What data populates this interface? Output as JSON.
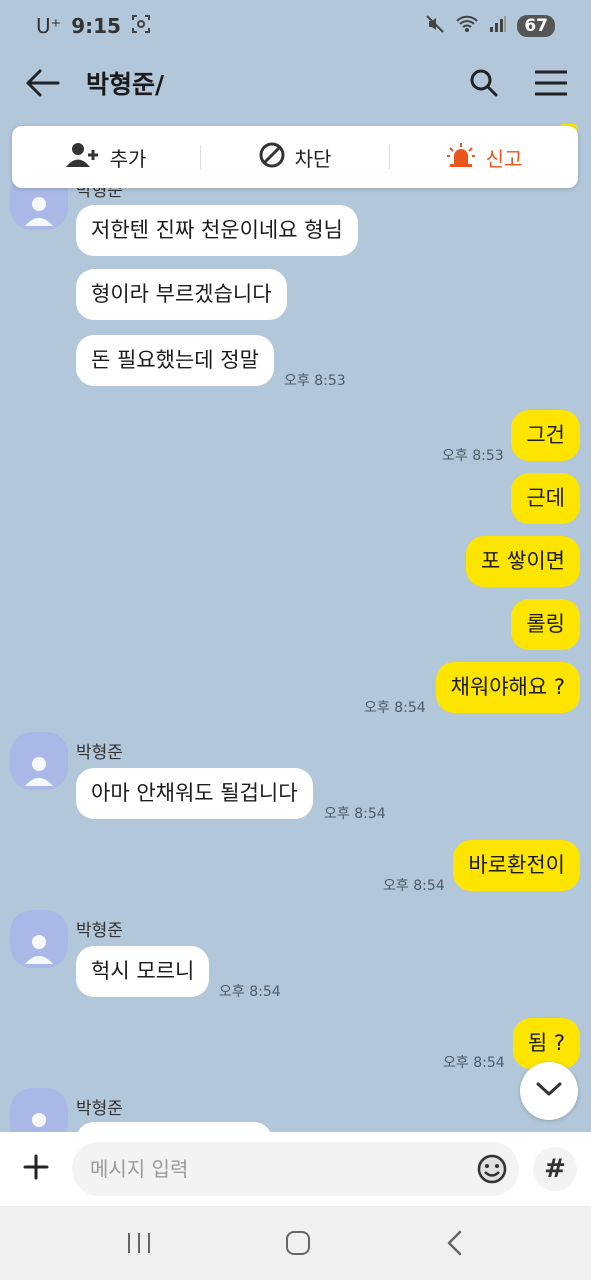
{
  "status": {
    "carrier": "U⁺",
    "time": "9:15",
    "battery": "67"
  },
  "header": {
    "title": "박형준/"
  },
  "actions": {
    "add": "추가",
    "block": "차단",
    "report": "신고"
  },
  "colors": {
    "background": "#b2c7d9",
    "my_bubble": "#fee500",
    "their_bubble": "#ffffff",
    "report": "#e8551d"
  },
  "messages": [
    {
      "from": "them",
      "sender_name": "박형준",
      "text": "저한텐 진짜 천운이네요 형님"
    },
    {
      "from": "them",
      "text": "형이라 부르겠습니다"
    },
    {
      "from": "them",
      "text": "돈 필요했는데 정말",
      "time": "오후 8:53"
    },
    {
      "from": "me",
      "text": "그건",
      "time": "오후 8:53"
    },
    {
      "from": "me",
      "text": "근데"
    },
    {
      "from": "me",
      "text": "포 쌓이면"
    },
    {
      "from": "me",
      "text": "롤링"
    },
    {
      "from": "me",
      "text": "채워야해요 ?",
      "time": "오후 8:54"
    },
    {
      "from": "them",
      "sender_name": "박형준",
      "text": "아마 안채워도 될겁니다",
      "time": "오후 8:54"
    },
    {
      "from": "me",
      "text": "바로환전이",
      "time": "오후 8:54"
    },
    {
      "from": "them",
      "sender_name": "박형준",
      "text": "헉시 모르니",
      "time": "오후 8:54"
    },
    {
      "from": "me",
      "text": "됨 ?",
      "time": "오후 8:54"
    },
    {
      "from": "them",
      "sender_name": "박형준",
      "text": ""
    }
  ],
  "input": {
    "placeholder": "메시지 입력"
  }
}
